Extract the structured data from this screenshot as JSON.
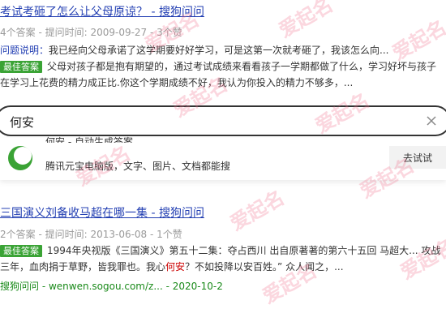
{
  "result1": {
    "title": "考试考砸了怎么让父母原谅？ - 搜狗问问",
    "meta": "4个答案 - 提问时间: 2009-09-27 - 3个赞",
    "question_label": "问题说明：",
    "question_text": "我已经向父母承诺了这学期要好好学习，可是这第一次就考砸了，我该怎么向...",
    "best_badge": "最佳答案",
    "answer_text": "父母对孩子都是抱有期望的，通过考试成绩来看看孩子一学期都做了什么，学习好坏与孩子在学习上花费的精力成正比.你这个学期成绩不好，我认为你投入的精力不够多，..."
  },
  "search": {
    "value": "何安",
    "clear_icon": "close-icon"
  },
  "suggestion": {
    "logo_icon": "tencent-yuanbao-logo",
    "title_cut": "何安 - 自动生成答案",
    "description": "腾讯元宝电脑版，文字、图片、文档都能搜",
    "button": "去试试"
  },
  "result2": {
    "title": "三国演义刘备收马超在哪一集 - 搜狗问问",
    "meta": "2个答案 - 提问时间: 2013-06-08 - 1个赞",
    "best_badge": "最佳答案",
    "answer_pre": "1994年央视版《三国演义》第五十二集：夺占西川 出自原著著的第六十五回 马超大... 攻战三年，血肉捐于草野，皆我罪也。我心",
    "answer_hl": "何安",
    "answer_post": "？不如投降以安百姓。” 众人闻之，...",
    "source_name": "搜狗问问",
    "source_rest": " - wenwen.sogou.com/z... - 2020-10-2"
  },
  "watermark": "爱起名"
}
